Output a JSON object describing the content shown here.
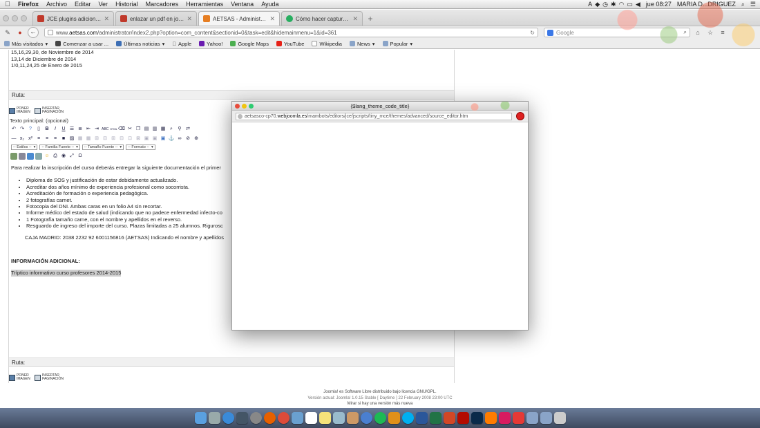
{
  "menubar": {
    "app": "Firefox",
    "items": [
      "Archivo",
      "Editar",
      "Ver",
      "Historial",
      "Marcadores",
      "Herramientas",
      "Ventana",
      "Ayuda"
    ],
    "clock": "jue 08:27",
    "user": "MARIA D...DRIGUEZ"
  },
  "tabs": [
    {
      "label": "JCE plugins adicionales - ...",
      "color": "#c0392b",
      "active": false
    },
    {
      "label": "enlazar un pdf en joomla ...",
      "color": "#c0392b",
      "active": false
    },
    {
      "label": "AETSAS - Administración [...",
      "color": "#e67e22",
      "active": true
    },
    {
      "label": "Cómo hacer capturas de p...",
      "color": "#27ae60",
      "active": false
    }
  ],
  "nav": {
    "url_prefix": "www.",
    "url_host": "aetsas.com",
    "url_path": "/administrator/index2.php?option=com_content&sectionid=0&task=edit&hidemainmenu=1&id=361",
    "search_placeholder": "Google"
  },
  "bookmarks": [
    {
      "label": "Más visitados",
      "menu": true
    },
    {
      "label": "Comenzar a usar ...",
      "menu": false
    },
    {
      "label": "Últimas noticias",
      "menu": true
    },
    {
      "label": "Apple",
      "menu": false
    },
    {
      "label": "Yahoo!",
      "menu": false
    },
    {
      "label": "Google Maps",
      "menu": false
    },
    {
      "label": "YouTube",
      "menu": false
    },
    {
      "label": "Wikipedia",
      "menu": false
    },
    {
      "label": "News",
      "menu": true
    },
    {
      "label": "Popular",
      "menu": true
    }
  ],
  "editor": {
    "dates": [
      "15,16,29,30, de Noviembre de 2014",
      "13,14 de Diciembre de 2014",
      "1!0,11,24,25 de Enero de 2015"
    ],
    "ruta_label": "Ruta:",
    "poner_imagen_label": "Poner imagen",
    "insertar_paginacion_label": "Insertar paginación",
    "texto_label": "Texto principal: (opcional)",
    "selects": [
      "-- Estilos --",
      "-- Familia Fuente --",
      "-- Tamaño Fuente --",
      "-- Formato --"
    ],
    "intro": "Para realizar la inscripción del curso deberás entregar la siguiente documentación el  primer",
    "requirements": [
      "Diploma de SOS y justificación de estar debidamente actualizado.",
      "Acreditar dos años mínimo de experiencia profesional como socorrista.",
      "Acreditación de formación o experiencia pedagógica.",
      "2 fotografías carnet.",
      "Fotocopia del DNI. Ambas caras en un folio A4 sin recortar.",
      "Informe médico del estado de salud (indicando que no padece enfermedad infecto-co",
      "1 Fotografía tamaño carne, con el nombre y apellidos en el reverso.",
      "Resguardo de ingreso del importe del curso.  Plazas limitadas a 25 alumnos. Rigurosc"
    ],
    "caja": "CAJA MADRID: 2038 2232 92 6001156816 (AETSAS) Indicando el nombre y apellidos",
    "info_heading": "INFORMACIÓN ADICIONAL:",
    "triptico": "Tríptico informativo curso profesores 2014-2015"
  },
  "footer": {
    "line1": "Joomla! es Software Libre distribuido bajo licencia GNU/GPL.",
    "line2": "Versión actual: Joomla! 1.0.15 Stable [ Daytime ] 22 February 2008 23:00 UTC",
    "line3": "Mirar si hay una versión más nueva"
  },
  "popup": {
    "title": "{$lang_theme_code_title}",
    "url_host_prefix": "aetsasco-cp70.",
    "url_host": "webjoomla.es",
    "url_path": "/mambots/editors/jce/jscripts/tiny_mce/themes/advanced/source_editor.htm"
  },
  "colors": {
    "accent_red": "#d22222",
    "dock_top": "#6a7b98"
  }
}
